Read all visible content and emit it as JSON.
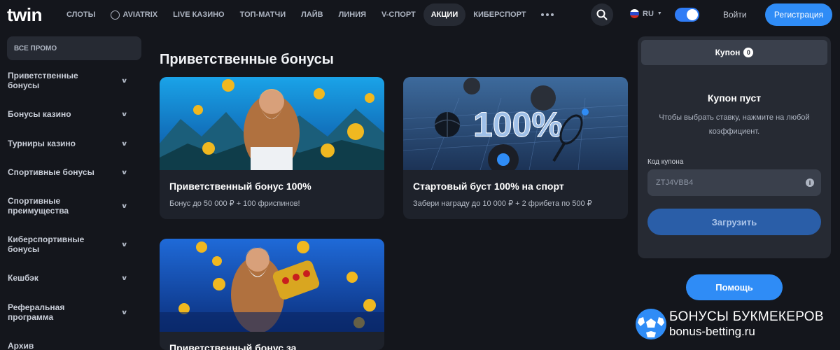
{
  "header": {
    "logo": "twin",
    "nav": [
      {
        "label": "СЛОТЫ"
      },
      {
        "label": "AVIATRIX"
      },
      {
        "label": "LIVE КАЗИНО"
      },
      {
        "label": "ТОП-МАТЧИ"
      },
      {
        "label": "ЛАЙВ"
      },
      {
        "label": "ЛИНИЯ"
      },
      {
        "label": "V-СПОРТ"
      },
      {
        "label": "АКЦИИ"
      },
      {
        "label": "КИБЕРСПОРТ"
      }
    ],
    "active_nav": "АКЦИИ",
    "language": "RU",
    "login_label": "Войти",
    "register_label": "Регистрация"
  },
  "sidebar": {
    "top_label": "ВСЕ ПРОМО",
    "items": [
      {
        "label": "Приветственные бонусы"
      },
      {
        "label": "Бонусы казино"
      },
      {
        "label": "Турниры казино"
      },
      {
        "label": "Спортивные бонусы"
      },
      {
        "label": "Спортивные преимущества"
      },
      {
        "label": "Киберспортивные бонусы"
      },
      {
        "label": "Кешбэк"
      },
      {
        "label": "Реферальная программа"
      },
      {
        "label": "Архив"
      }
    ]
  },
  "main": {
    "section_title": "Приветственные бонусы",
    "cards": [
      {
        "title": "Приветственный бонус 100%",
        "subtitle": "Бонус до 50 000 ₽ + 100 фриспинов!"
      },
      {
        "title": "Стартовый буст 100% на спорт",
        "subtitle": "Забери награду до 10 000 ₽ + 2 фрибета по 500 ₽"
      },
      {
        "title": "Приветственный бонус за",
        "subtitle": ""
      }
    ],
    "banner2_text": "100%"
  },
  "coupon": {
    "tab_label": "Купон",
    "count": "0",
    "empty_title": "Купон пуст",
    "hint": "Чтобы выбрать ставку, нажмите на любой коэффициент.",
    "code_label": "Код купона",
    "code_value": "ZTJ4VBB4",
    "load_label": "Загрузить"
  },
  "help_label": "Помощь",
  "watermark": {
    "line1": "БОНУСЫ БУКМЕКЕРОВ",
    "line2": "bonus-betting.ru"
  },
  "colors": {
    "background": "#14161c",
    "panel": "#262a33",
    "accent": "#2f8cf6"
  }
}
